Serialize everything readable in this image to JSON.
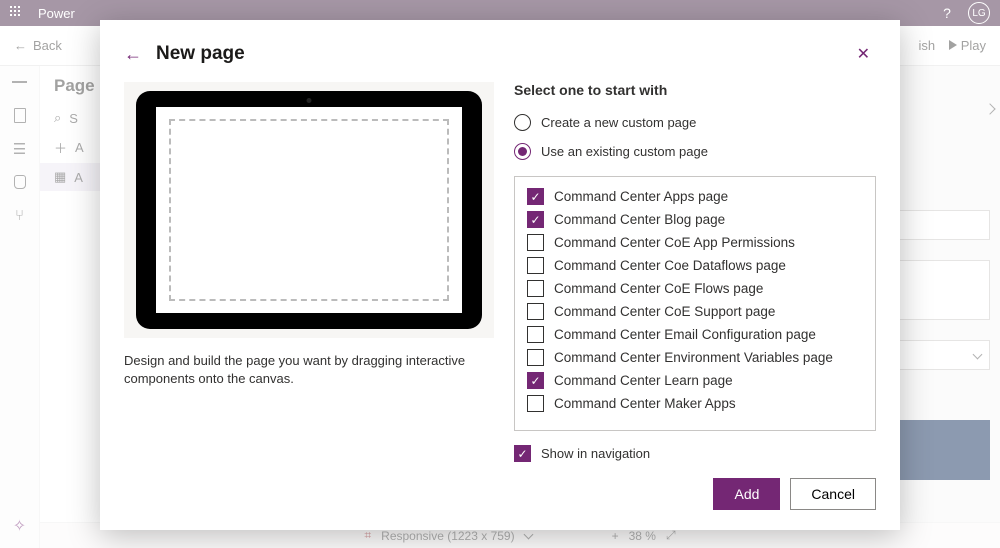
{
  "app": {
    "name": "Power",
    "help_glyph": "?",
    "user_initials": "LG"
  },
  "cmdbar": {
    "back": "Back",
    "publish_suffix": "ish",
    "play": "Play"
  },
  "panel": {
    "title": "Page",
    "add_prefix": "A",
    "search_prefix": "S",
    "item_prefix": "A"
  },
  "status": {
    "mode": "Responsive (1223 x 759)",
    "plus": "+",
    "zoom": "38 %"
  },
  "dialog": {
    "title": "New page",
    "preview_text": "Design and build the page you want by dragging interactive components onto the canvas.",
    "select_heading": "Select one to start with",
    "radio_create": "Create a new custom page",
    "radio_existing": "Use an existing custom page",
    "show_nav": "Show in navigation",
    "add": "Add",
    "cancel": "Cancel",
    "options": [
      {
        "label": "Command Center Apps page",
        "checked": true
      },
      {
        "label": "Command Center Blog page",
        "checked": true
      },
      {
        "label": "Command Center CoE App Permissions",
        "checked": false
      },
      {
        "label": "Command Center Coe Dataflows page",
        "checked": false
      },
      {
        "label": "Command Center CoE Flows page",
        "checked": false
      },
      {
        "label": "Command Center CoE Support page",
        "checked": false
      },
      {
        "label": "Command Center Email Configuration page",
        "checked": false
      },
      {
        "label": "Command Center Environment Variables page",
        "checked": false
      },
      {
        "label": "Command Center Learn page",
        "checked": true
      },
      {
        "label": "Command Center Maker Apps",
        "checked": false
      }
    ]
  }
}
